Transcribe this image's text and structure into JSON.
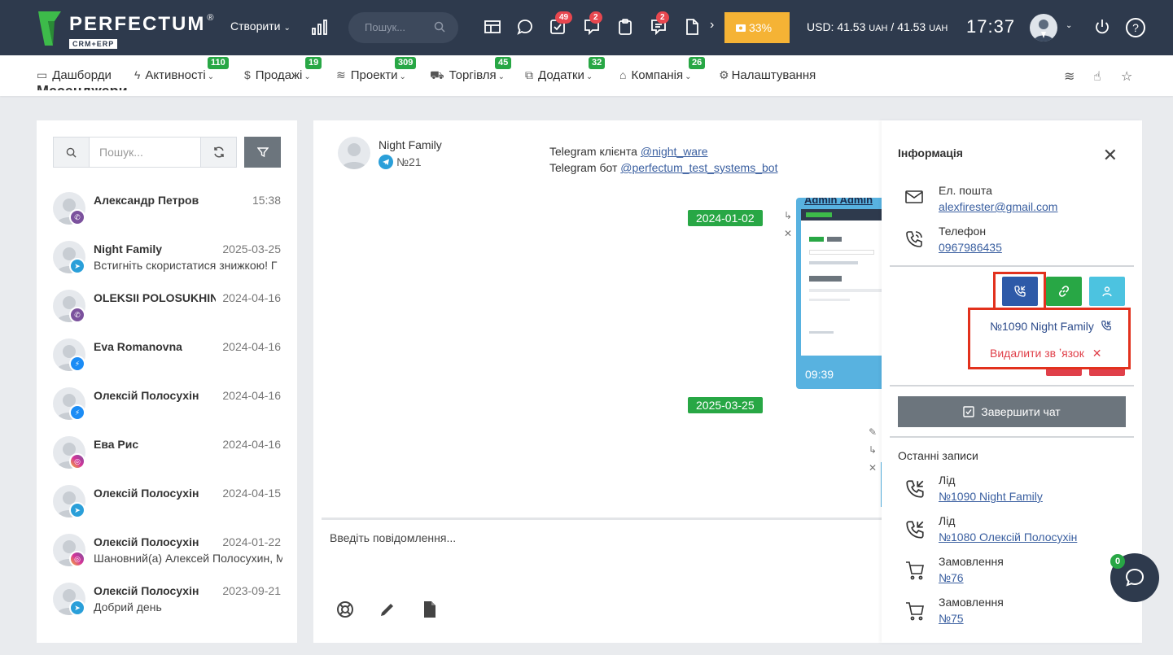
{
  "topbar": {
    "logo_name": "PERFECTUM",
    "logo_reg": "®",
    "logo_sub": "CRM+ERP",
    "create_label": "Створити",
    "search_placeholder": "Пошук...",
    "badges": {
      "tasks": "49",
      "comments": "2",
      "notes": "2"
    },
    "progress": "33%",
    "currency_usd": "USD:",
    "currency_a": "41.53",
    "currency_unit": "UAH",
    "currency_sep": "/",
    "currency_b": "41.53",
    "time": "17:37",
    "help": "?"
  },
  "nav": {
    "items": [
      {
        "label": "Дашборди",
        "badge": ""
      },
      {
        "label": "Активності",
        "badge": "110"
      },
      {
        "label": "Продажі",
        "badge": "19"
      },
      {
        "label": "Проекти",
        "badge": "309"
      },
      {
        "label": "Торгівля",
        "badge": "45"
      },
      {
        "label": "Додатки",
        "badge": "32"
      },
      {
        "label": "Компанія",
        "badge": "26"
      },
      {
        "label": "Налаштування",
        "badge": ""
      }
    ]
  },
  "page": {
    "title_under": "Месенджери"
  },
  "left": {
    "search_placeholder": "Пошук...",
    "chats": [
      {
        "name": "Александр Петров",
        "time": "15:38",
        "msg": "",
        "channel": "viber"
      },
      {
        "name": "Night Family",
        "time": "2025-03-25",
        "msg": "Встигніть скористатися знижкою! Г",
        "channel": "telegram"
      },
      {
        "name": "OLEKSII POLOSUKHIN",
        "time": "2024-04-16",
        "msg": "",
        "channel": "viber"
      },
      {
        "name": "Eva Romanovna",
        "time": "2024-04-16",
        "msg": "",
        "channel": "messenger"
      },
      {
        "name": "Олексій Полосухін",
        "time": "2024-04-16",
        "msg": "",
        "channel": "messenger"
      },
      {
        "name": "Ева Рис",
        "time": "2024-04-16",
        "msg": "",
        "channel": "instagram"
      },
      {
        "name": "Олексій Полосухін",
        "time": "2024-04-15",
        "msg": "",
        "channel": "telegram"
      },
      {
        "name": "Олексій Полосухін",
        "time": "2024-01-22",
        "msg": "Шановний(а) Алексей Полосухин, М",
        "channel": "instagram"
      },
      {
        "name": "Олексій Полосухін",
        "time": "2023-09-21",
        "msg": "Добрий день",
        "channel": "telegram"
      }
    ]
  },
  "chat": {
    "contact_name": "Night Family",
    "contact_num": "№21",
    "info_client_label": "Telegram клієнта",
    "info_client_handle": "@night_ware",
    "info_bot_label": "Telegram бот",
    "info_bot_handle": "@perfectum_test_systems_bot",
    "date1": "2024-01-02",
    "img_time": "09:39",
    "img_caption": "Admin Admin",
    "date2": "2025-03-25",
    "compose_placeholder": "Введіть повідомлення..."
  },
  "info": {
    "title": "Інформація",
    "email_label": "Ел. пошта",
    "email": "alexfirester@gmail.com",
    "phone_label": "Телефон",
    "phone": "0967986435",
    "dropdown_link": "№1090 Night Family",
    "dropdown_unlink": "Видалити зв ʼязок",
    "finish_chat": "Завершити чат",
    "recent_title": "Останні записи",
    "recent": [
      {
        "type": "Лід",
        "link": "№1090 Night Family",
        "icon": "phone-incoming-icon"
      },
      {
        "type": "Лід",
        "link": "№1080 Олексій Полосухін",
        "icon": "phone-incoming-icon"
      },
      {
        "type": "Замовлення",
        "link": "№76",
        "icon": "cart-icon"
      },
      {
        "type": "Замовлення",
        "link": "№75",
        "icon": "cart-icon"
      }
    ]
  },
  "fab": {
    "badge": "0"
  },
  "colors": {
    "topbar": "#2e3a4d",
    "accent_green": "#28a745",
    "highlight_red": "#e2311d",
    "telegram": "#2a9fd9",
    "progress": "#f5b335"
  }
}
